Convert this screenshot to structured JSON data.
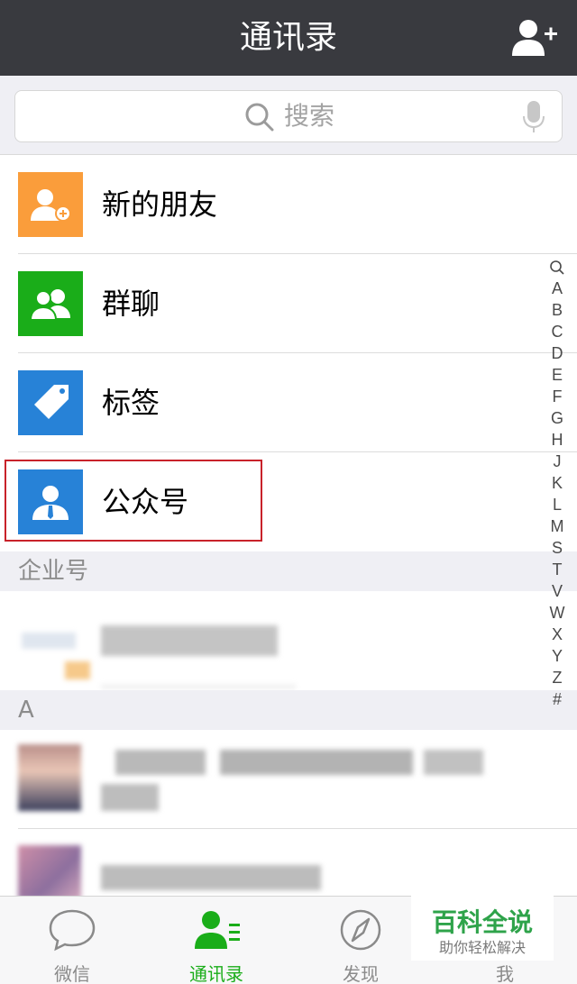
{
  "header": {
    "title": "通讯录",
    "add_icon": "add-contact-icon"
  },
  "search": {
    "placeholder": "搜索",
    "icon": "search-icon",
    "voice_icon": "microphone-icon"
  },
  "menu_items": [
    {
      "label": "新的朋友",
      "icon": "new-friends-icon",
      "color": "#fa9d3b"
    },
    {
      "label": "群聊",
      "icon": "group-chat-icon",
      "color": "#1aad19"
    },
    {
      "label": "标签",
      "icon": "tag-icon",
      "color": "#2782d7"
    },
    {
      "label": "公众号",
      "icon": "official-account-icon",
      "color": "#2782d7"
    }
  ],
  "sections": {
    "enterprise": "企业号",
    "letter_a": "A"
  },
  "index_letters": [
    "A",
    "B",
    "C",
    "D",
    "E",
    "F",
    "G",
    "H",
    "J",
    "K",
    "L",
    "M",
    "S",
    "T",
    "V",
    "W",
    "X",
    "Y",
    "Z",
    "#"
  ],
  "tabs": [
    {
      "label": "微信",
      "icon": "chat-bubble-icon",
      "active": false
    },
    {
      "label": "通讯录",
      "icon": "contacts-icon",
      "active": true
    },
    {
      "label": "发现",
      "icon": "compass-icon",
      "active": false
    },
    {
      "label": "我",
      "icon": "me-icon",
      "active": false
    }
  ],
  "watermark": {
    "title": "百科全说",
    "subtitle": "助你轻松解决"
  },
  "colors": {
    "header_bg": "#393a3f",
    "accent_green": "#1aad19",
    "highlight_red": "#c8222a"
  }
}
